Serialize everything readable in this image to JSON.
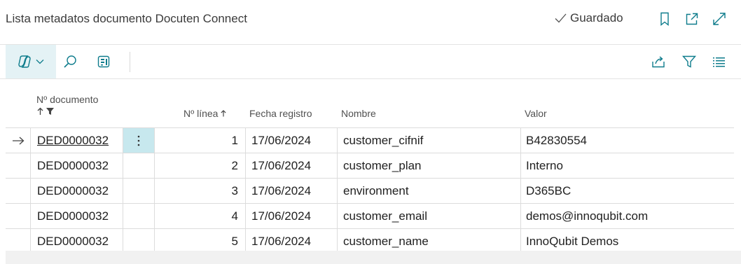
{
  "header": {
    "title": "Lista metadatos documento Docuten Connect",
    "saved_label": "Guardado",
    "icons": [
      "bookmark-icon",
      "open-new-window-icon",
      "expand-icon"
    ]
  },
  "toolbar": {
    "left_icons": [
      "copilot-icon",
      "chevron-down-icon",
      "search-icon",
      "edit-list-icon"
    ],
    "right_icons": [
      "share-icon",
      "filter-icon",
      "list-view-icon"
    ]
  },
  "table": {
    "columns": {
      "doc": "Nº documento",
      "line": "Nº línea",
      "date": "Fecha registro",
      "name": "Nombre",
      "value": "Valor"
    },
    "rows": [
      {
        "doc": "DED0000032",
        "line": "1",
        "date": "17/06/2024",
        "name": "customer_cifnif",
        "value": "B42830554"
      },
      {
        "doc": "DED0000032",
        "line": "2",
        "date": "17/06/2024",
        "name": "customer_plan",
        "value": "Interno"
      },
      {
        "doc": "DED0000032",
        "line": "3",
        "date": "17/06/2024",
        "name": "environment",
        "value": "D365BC"
      },
      {
        "doc": "DED0000032",
        "line": "4",
        "date": "17/06/2024",
        "name": "customer_email",
        "value": "demos@innoqubit.com"
      },
      {
        "doc": "DED0000032",
        "line": "5",
        "date": "17/06/2024",
        "name": "customer_name",
        "value": "InnoQubit Demos"
      }
    ]
  },
  "colors": {
    "accent": "#0e7c8c",
    "toolbar_active_bg": "#e4f2f5",
    "row_menu_active_bg": "#c7e8ee"
  }
}
